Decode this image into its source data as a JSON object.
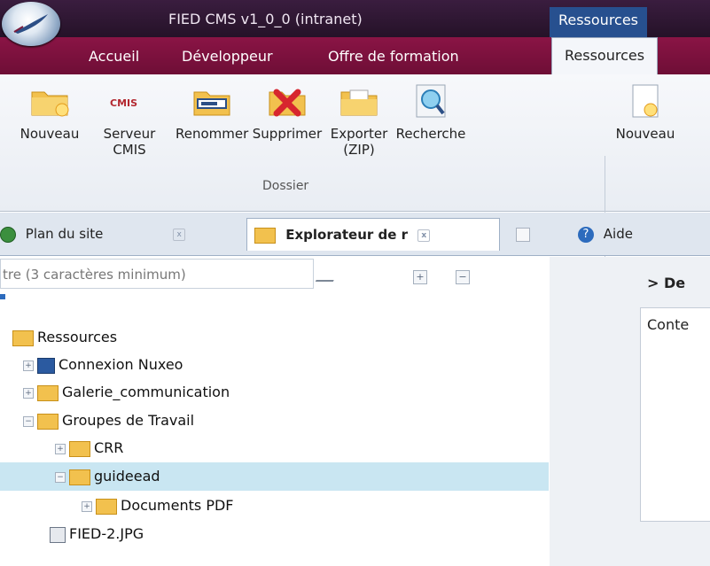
{
  "app_title": "FIED CMS v1_0_0 (intranet)",
  "context_tab": "Ressources",
  "menu_tabs": [
    "Accueil",
    "Développeur",
    "Offre de formation",
    "Ressources"
  ],
  "ribbon": {
    "buttons": [
      {
        "label": "Nouveau",
        "icon": "folder-new-icon"
      },
      {
        "label": "Serveur\nCMIS",
        "icon": "cmis-server-icon"
      },
      {
        "label": "Renommer",
        "icon": "folder-rename-icon"
      },
      {
        "label": "Supprimer",
        "icon": "folder-delete-icon"
      },
      {
        "label": "Exporter\n(ZIP)",
        "icon": "folder-export-icon"
      },
      {
        "label": "Recherche",
        "icon": "search-icon"
      },
      {
        "label": "Nouveau",
        "icon": "file-new-icon"
      }
    ],
    "cmis_badge": "CMIS",
    "group_label": "Dossier"
  },
  "page_tabs": [
    "Plan du site",
    "Explorateur de r",
    "Aide"
  ],
  "filter": {
    "placeholder": "tre (3 caractères minimum)"
  },
  "tree": [
    {
      "label": "Ressources"
    },
    {
      "label": "Connexion Nuxeo"
    },
    {
      "label": "Galerie_communication"
    },
    {
      "label": "Groupes de Travail"
    },
    {
      "label": "CRR"
    },
    {
      "label": "guideead"
    },
    {
      "label": "Documents PDF"
    },
    {
      "label": "FIED-2.JPG"
    }
  ],
  "right_panel": {
    "header": "De",
    "column": "Conte"
  },
  "colors": {
    "title_bg": "#3a1d3f",
    "menu_bg": "#8a1445",
    "context_tab": "#27508f",
    "selection": "#c9e6f2"
  }
}
